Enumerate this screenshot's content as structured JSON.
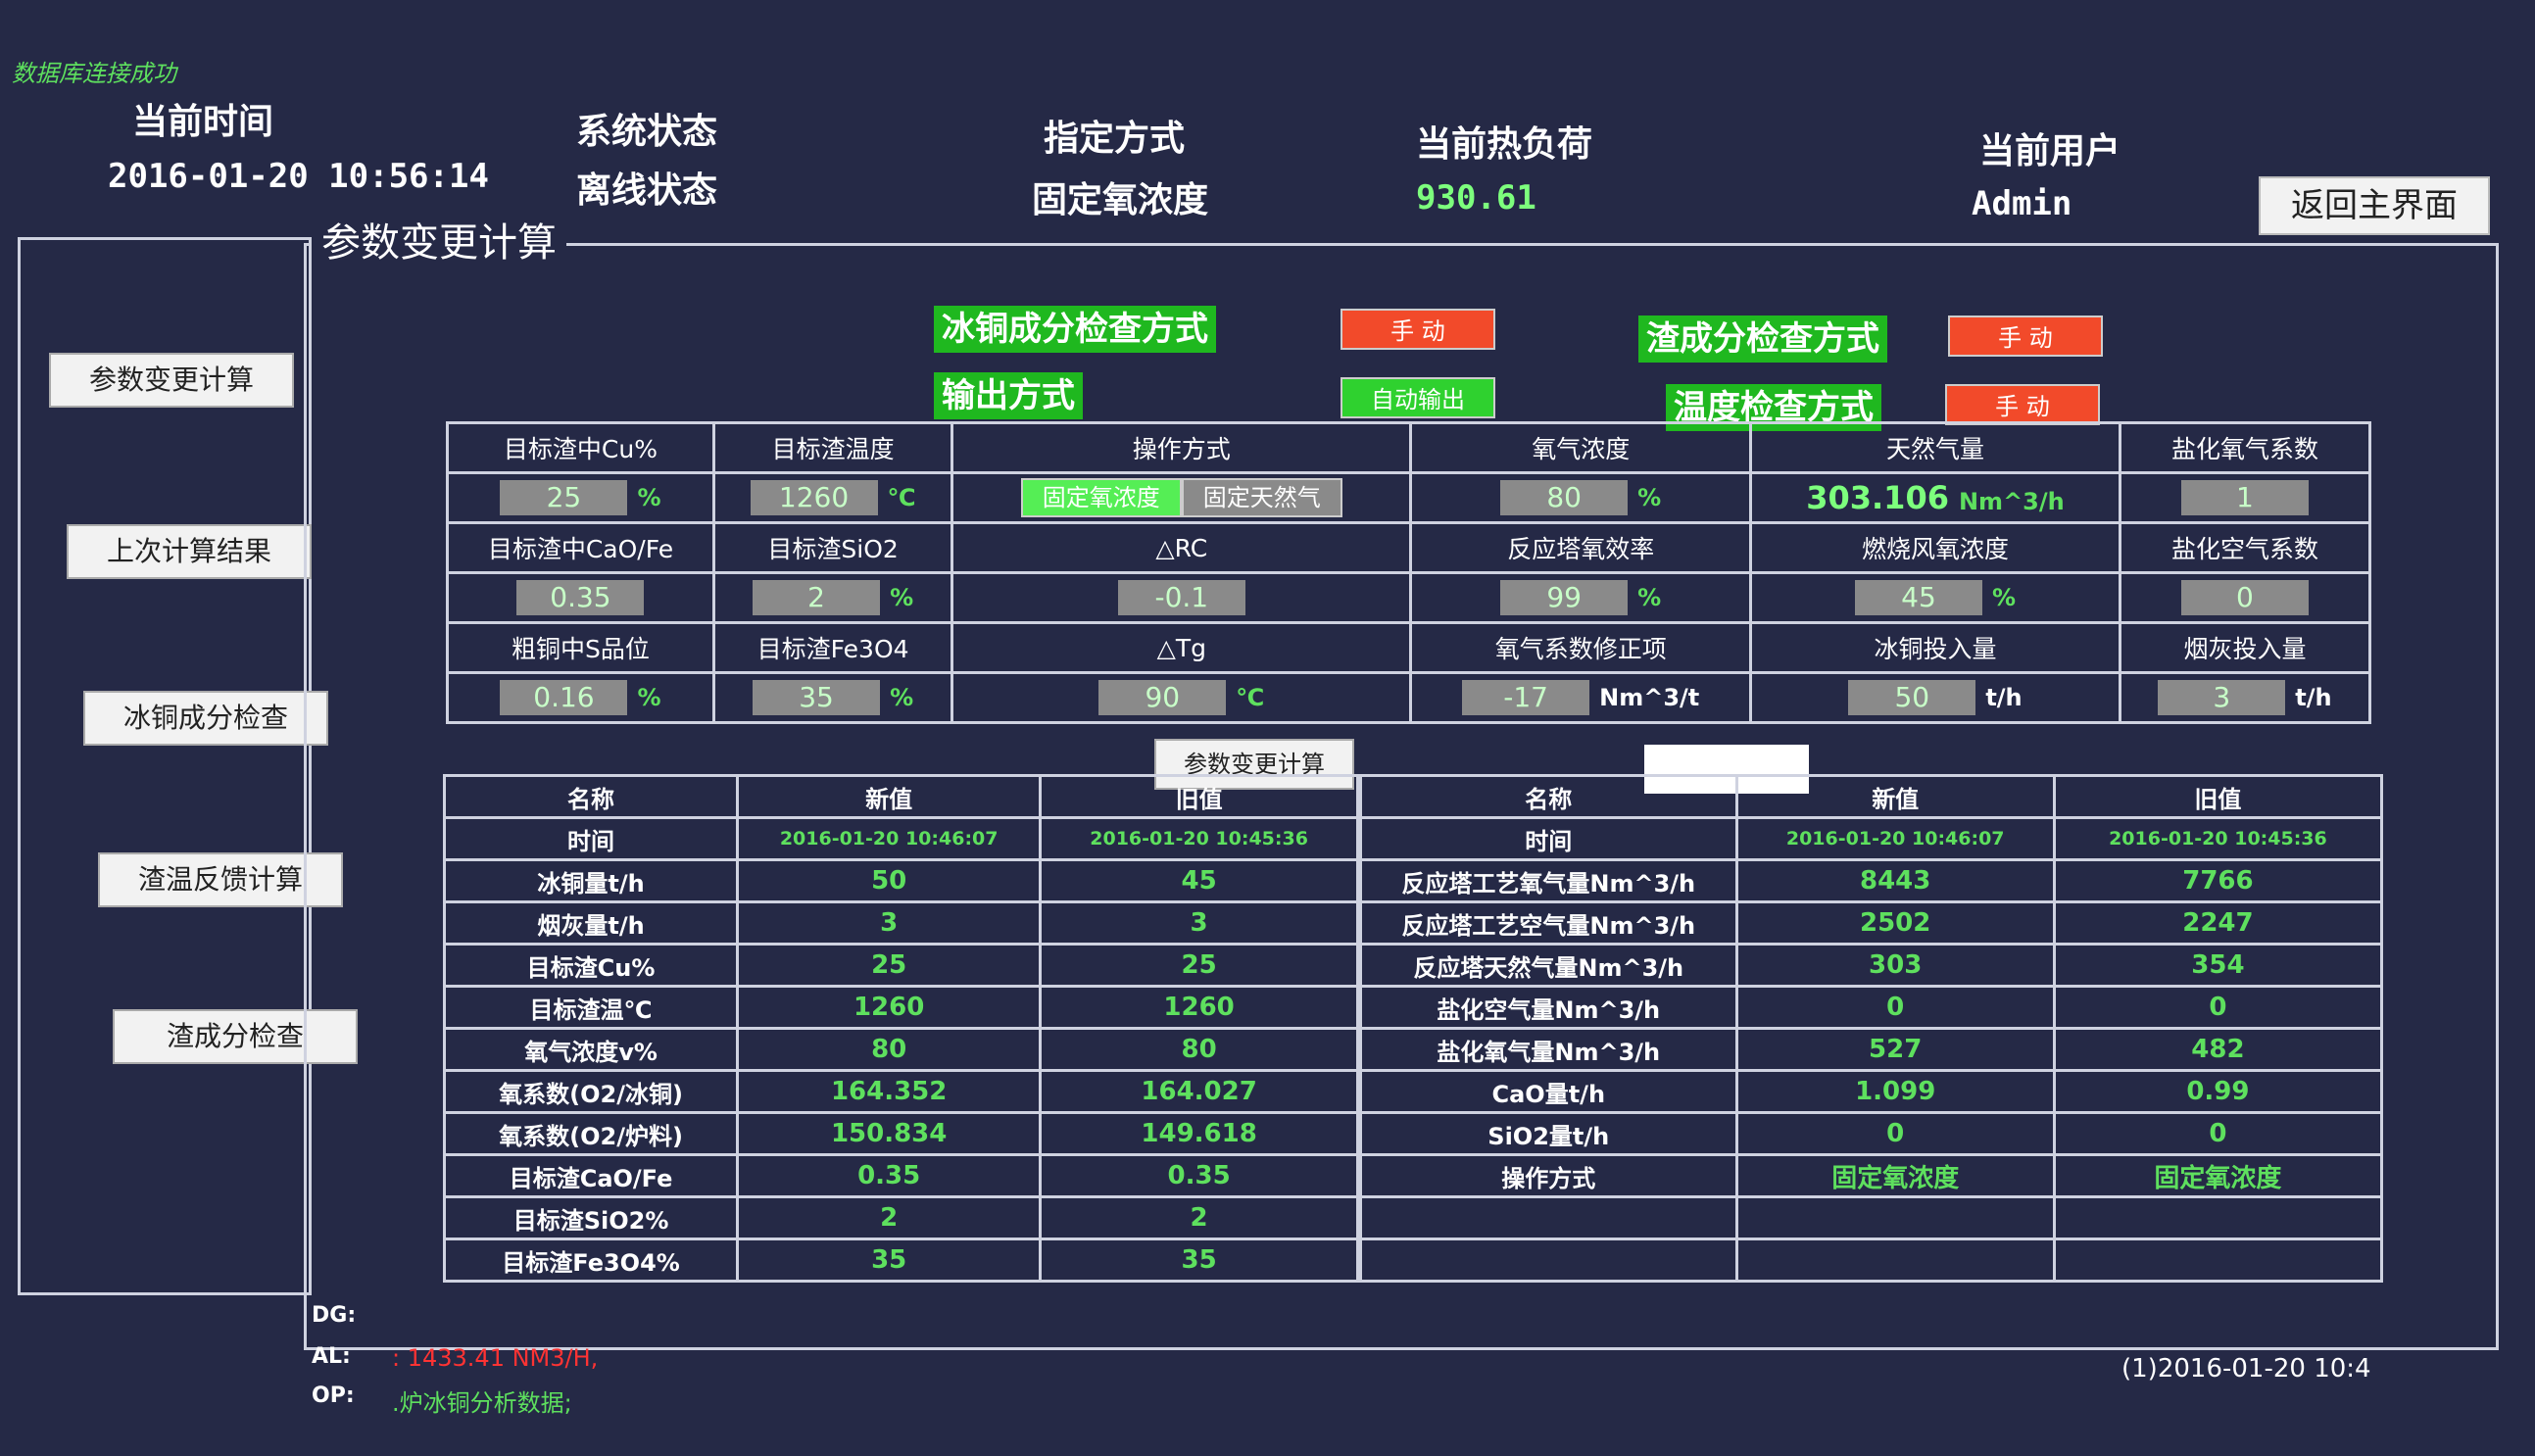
{
  "status_message": "数据库连接成功",
  "header": {
    "time_label": "当前时间",
    "time_value": "2016-01-20 10:56:14",
    "system_label": "系统状态",
    "system_value": "离线状态",
    "method_label": "指定方式",
    "method_value": "固定氧浓度",
    "heat_label": "当前热负荷",
    "heat_value": "930.61",
    "user_label": "当前用户",
    "user_value": "Admin",
    "back_button": "返回主界面"
  },
  "group_title": "参数变更计算",
  "sidebar": {
    "items": [
      "参数变更计算",
      "上次计算结果",
      "冰铜成分检查",
      "渣温反馈计算",
      "渣成分检查"
    ]
  },
  "modes": {
    "matte_check_label": "冰铜成分检查方式",
    "matte_check_value": "手  动",
    "output_label": "输出方式",
    "output_value": "自动输出",
    "slag_check_label": "渣成分检查方式",
    "slag_check_value": "手  动",
    "temp_check_label": "温度检查方式",
    "temp_check_value": "手  动"
  },
  "params": {
    "target_cu_label": "目标渣中Cu%",
    "target_cu": "25",
    "target_cu_unit": "%",
    "target_temp_label": "目标渣温度",
    "target_temp": "1260",
    "target_temp_unit": "℃",
    "op_mode_label": "操作方式",
    "op_mode_a": "固定氧浓度",
    "op_mode_b": "固定天然气",
    "o2_conc_label": "氧气浓度",
    "o2_conc": "80",
    "o2_conc_unit": "%",
    "gas_label": "天然气量",
    "gas": "303.106",
    "gas_unit": "Nm^3/h",
    "chlor_o2_label": "盐化氧气系数",
    "chlor_o2": "1",
    "cao_fe_label": "目标渣中CaO/Fe",
    "cao_fe": "0.35",
    "sio2_label": "目标渣SiO2",
    "sio2": "2",
    "sio2_unit": "%",
    "drc_label": "△RC",
    "drc": "-0.1",
    "tower_eff_label": "反应塔氧效率",
    "tower_eff": "99",
    "tower_eff_unit": "%",
    "air_o2_label": "燃烧风氧浓度",
    "air_o2": "45",
    "air_o2_unit": "%",
    "chlor_air_label": "盐化空气系数",
    "chlor_air": "0",
    "s_grade_label": "粗铜中S品位",
    "s_grade": "0.16",
    "s_grade_unit": "%",
    "fe3o4_label": "目标渣Fe3O4",
    "fe3o4": "35",
    "fe3o4_unit": "%",
    "dtg_label": "△Tg",
    "dtg": "90",
    "dtg_unit": "℃",
    "o2_corr_label": "氧气系数修正项",
    "o2_corr": "-17",
    "o2_corr_unit": "Nm^3/t",
    "matte_in_label": "冰铜投入量",
    "matte_in": "50",
    "matte_in_unit": "t/h",
    "dust_in_label": "烟灰投入量",
    "dust_in": "3",
    "dust_in_unit": "t/h",
    "calc_button": "参数变更计算"
  },
  "results": {
    "headers": {
      "name": "名称",
      "new": "新值",
      "old": "旧值"
    },
    "left_rows": [
      {
        "name": "时间",
        "new": "2016-01-20 10:46:07",
        "old": "2016-01-20 10:45:36"
      },
      {
        "name": "冰铜量t/h",
        "new": "50",
        "old": "45"
      },
      {
        "name": "烟灰量t/h",
        "new": "3",
        "old": "3"
      },
      {
        "name": "目标渣Cu%",
        "new": "25",
        "old": "25"
      },
      {
        "name": "目标渣温℃",
        "new": "1260",
        "old": "1260"
      },
      {
        "name": "氧气浓度v%",
        "new": "80",
        "old": "80"
      },
      {
        "name": "氧系数(O2/冰铜)",
        "new": "164.352",
        "old": "164.027"
      },
      {
        "name": "氧系数(O2/炉料)",
        "new": "150.834",
        "old": "149.618"
      },
      {
        "name": "目标渣CaO/Fe",
        "new": "0.35",
        "old": "0.35"
      },
      {
        "name": "目标渣SiO2%",
        "new": "2",
        "old": "2"
      },
      {
        "name": "目标渣Fe3O4%",
        "new": "35",
        "old": "35"
      }
    ],
    "right_rows": [
      {
        "name": "时间",
        "new": "2016-01-20 10:46:07",
        "old": "2016-01-20 10:45:36"
      },
      {
        "name": "反应塔工艺氧气量Nm^3/h",
        "new": "8443",
        "old": "7766"
      },
      {
        "name": "反应塔工艺空气量Nm^3/h",
        "new": "2502",
        "old": "2247"
      },
      {
        "name": "反应塔天然气量Nm^3/h",
        "new": "303",
        "old": "354"
      },
      {
        "name": "盐化空气量Nm^3/h",
        "new": "0",
        "old": "0"
      },
      {
        "name": "盐化氧气量Nm^3/h",
        "new": "527",
        "old": "482"
      },
      {
        "name": "CaO量t/h",
        "new": "1.099",
        "old": "0.99"
      },
      {
        "name": "SiO2量t/h",
        "new": "0",
        "old": "0"
      },
      {
        "name": "操作方式",
        "new": "固定氧浓度",
        "old": "固定氧浓度"
      },
      {
        "name": "",
        "new": "",
        "old": ""
      },
      {
        "name": "",
        "new": "",
        "old": ""
      }
    ]
  },
  "bottom": {
    "dg_label": "DG:",
    "al_label": "AL:",
    "al_text": ": 1433.41 NM3/H,",
    "op_label": "OP:",
    "op_text": ".炉冰铜分析数据;",
    "right_text": "(1)2016-01-20  10:4"
  }
}
